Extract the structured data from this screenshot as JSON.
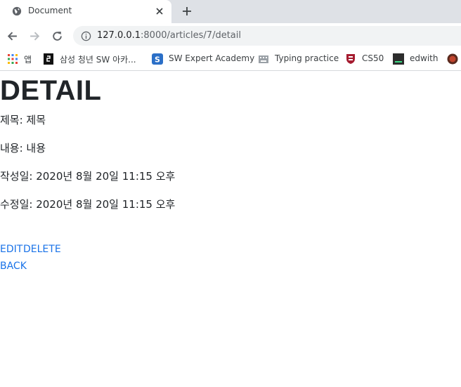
{
  "tab": {
    "title": "Document"
  },
  "address_bar": {
    "host": "127.0.0.1",
    "path": ":8000/articles/7/detail"
  },
  "bookmarks": [
    {
      "label": "앱",
      "icon": "apps-grid-icon"
    },
    {
      "label": "삼성 청년 SW 아카...",
      "icon": "ssafy-icon"
    },
    {
      "label": "SW Expert Academy",
      "icon": "swea-icon"
    },
    {
      "label": "Typing practice",
      "icon": "typing-icon"
    },
    {
      "label": "CS50",
      "icon": "harvard-shield-icon"
    },
    {
      "label": "edwith",
      "icon": "edwith-icon"
    },
    {
      "label": "",
      "icon": "bookmark-overflow-icon"
    }
  ],
  "article": {
    "heading": "DETAIL",
    "title_line": "제목: 제목",
    "content_line": "내용: 내용",
    "created_line": "작성일: 2020년 8월 20일 11:15 오후",
    "updated_line": "수정일: 2020년 8월 20일 11:15 오후"
  },
  "actions": {
    "edit": "EDIT",
    "delete": "DELETE",
    "back": "BACK"
  },
  "colors": {
    "tabstrip": "#dee1e6",
    "link": "#1a73e8",
    "text": "#212529"
  }
}
